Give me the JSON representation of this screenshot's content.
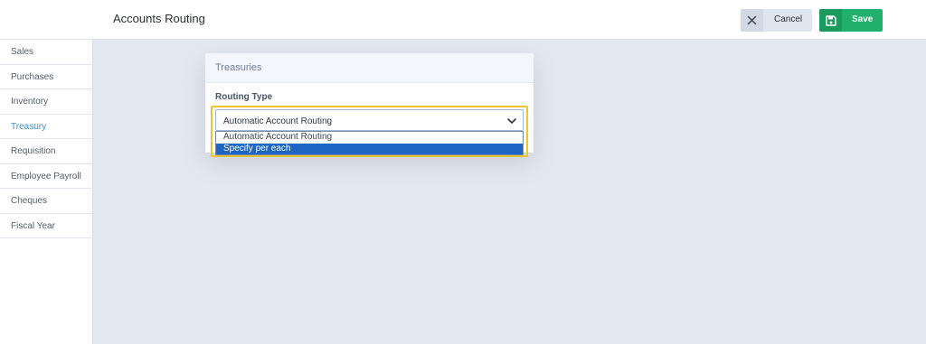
{
  "header": {
    "title": "Accounts Routing",
    "cancel_label": "Cancel",
    "save_label": "Save"
  },
  "sidebar": {
    "items": [
      {
        "label": "Sales"
      },
      {
        "label": "Purchases"
      },
      {
        "label": "Inventory"
      },
      {
        "label": "Treasury"
      },
      {
        "label": "Requisition"
      },
      {
        "label": "Employee Payroll"
      },
      {
        "label": "Cheques"
      },
      {
        "label": "Fiscal Year"
      }
    ],
    "active_index": 3
  },
  "card": {
    "title": "Treasuries",
    "routing_label": "Routing Type",
    "selected_value": "Automatic Account Routing",
    "options": [
      {
        "label": "Automatic Account Routing"
      },
      {
        "label": "Specify per each"
      }
    ],
    "highlighted_option_index": 1
  },
  "colors": {
    "accent": "#3a8fd0",
    "save_green": "#20b06b",
    "highlight_blue": "#1f66c4",
    "focus_yellow": "#f1c232"
  },
  "icons": {
    "cancel": "close-icon",
    "save": "floppy-disk-icon",
    "select": "chevron-down-icon"
  }
}
